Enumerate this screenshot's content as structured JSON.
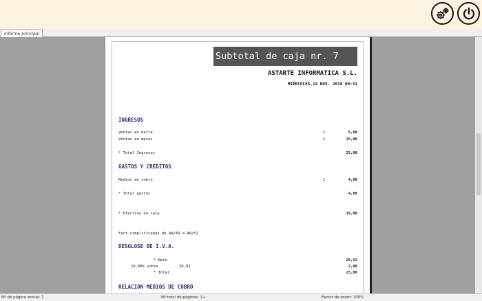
{
  "toolbar": {
    "settings_icon": "gears-icon",
    "power_icon": "power-icon"
  },
  "tabs": [
    {
      "label": "Informe principal"
    }
  ],
  "report": {
    "title": "Subtotal de caja nr. 7",
    "company": "ASTARTE INFORMATICA S.L.",
    "date": "MIÉRCOLES,14 NOV. 2018 09:31",
    "ingresos": {
      "heading": "INGRESOS",
      "rows": [
        {
          "label": "Ventas en barra",
          "qty": "1",
          "amount": "8,00"
        },
        {
          "label": "Ventas en mesas",
          "qty": "2",
          "amount": "15,00"
        }
      ],
      "total_label": "* Total Ingresos",
      "total": "23,00"
    },
    "gastos": {
      "heading": "GASTOS Y CREDITOS",
      "rows": [
        {
          "label": "Medios de cobro",
          "qty": "1",
          "amount": "4,00"
        }
      ],
      "total_label": "* Total gastos",
      "total": "4,00"
    },
    "efectivo": {
      "label": "* Efectivo en caja",
      "amount": "19,00"
    },
    "facturas": "Fact.simplificadas de AA/49 a AA/51",
    "iva": {
      "heading": "DESGLOSE DE I.V.A.",
      "neto_label": "* Neto",
      "neto": "20,92",
      "rate_label": "10,00% sobre",
      "rate_base": "20,92",
      "rate_amount": "2,08",
      "total_label": "* Total",
      "total": "23,00"
    },
    "medios_heading": "RELACION MEDIOS DE COBRO"
  },
  "status": {
    "current_page": "Nº de página actual: 1",
    "total_pages": "Nº total de páginas: 1+",
    "zoom": "Factor de zoom: 100%"
  }
}
